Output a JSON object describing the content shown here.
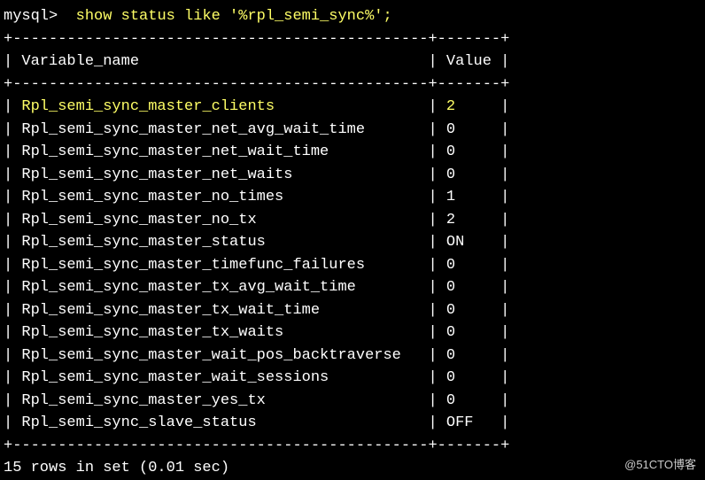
{
  "prompt": "mysql>  ",
  "command": "show status like '%rpl_semi_sync%';",
  "table": {
    "divider": "+----------------------------------------------+-------+",
    "header": {
      "col1": "Variable_name",
      "col2": "Value"
    },
    "rows": [
      {
        "name": "Rpl_semi_sync_master_clients",
        "value": "2",
        "highlight": true
      },
      {
        "name": "Rpl_semi_sync_master_net_avg_wait_time",
        "value": "0",
        "highlight": false
      },
      {
        "name": "Rpl_semi_sync_master_net_wait_time",
        "value": "0",
        "highlight": false
      },
      {
        "name": "Rpl_semi_sync_master_net_waits",
        "value": "0",
        "highlight": false
      },
      {
        "name": "Rpl_semi_sync_master_no_times",
        "value": "1",
        "highlight": false
      },
      {
        "name": "Rpl_semi_sync_master_no_tx",
        "value": "2",
        "highlight": false
      },
      {
        "name": "Rpl_semi_sync_master_status",
        "value": "ON",
        "highlight": false
      },
      {
        "name": "Rpl_semi_sync_master_timefunc_failures",
        "value": "0",
        "highlight": false
      },
      {
        "name": "Rpl_semi_sync_master_tx_avg_wait_time",
        "value": "0",
        "highlight": false
      },
      {
        "name": "Rpl_semi_sync_master_tx_wait_time",
        "value": "0",
        "highlight": false
      },
      {
        "name": "Rpl_semi_sync_master_tx_waits",
        "value": "0",
        "highlight": false
      },
      {
        "name": "Rpl_semi_sync_master_wait_pos_backtraverse",
        "value": "0",
        "highlight": false
      },
      {
        "name": "Rpl_semi_sync_master_wait_sessions",
        "value": "0",
        "highlight": false
      },
      {
        "name": "Rpl_semi_sync_master_yes_tx",
        "value": "0",
        "highlight": false
      },
      {
        "name": "Rpl_semi_sync_slave_status",
        "value": "OFF",
        "highlight": false
      }
    ]
  },
  "footer": "15 rows in set (0.01 sec)",
  "watermark": "@51CTO博客",
  "col1_width": 44,
  "col2_width": 5
}
